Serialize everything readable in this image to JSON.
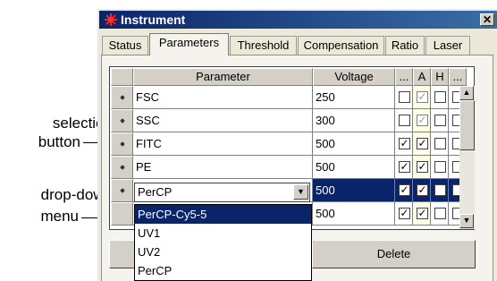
{
  "window": {
    "title": "Instrument"
  },
  "tabs": [
    "Status",
    "Parameters",
    "Threshold",
    "Compensation",
    "Ratio",
    "Laser"
  ],
  "active_tab": "Parameters",
  "grid": {
    "headers": {
      "parameter": "Parameter",
      "voltage": "Voltage",
      "col_more1": "...",
      "col_a": "A",
      "col_h": "H",
      "col_more2": "..."
    },
    "rows": [
      {
        "parameter": "FSC",
        "voltage": "250",
        "log": false,
        "a": true,
        "a_disabled": true,
        "h": false,
        "w": false,
        "selected": false
      },
      {
        "parameter": "SSC",
        "voltage": "300",
        "log": false,
        "a": true,
        "a_disabled": true,
        "h": false,
        "w": false,
        "selected": false
      },
      {
        "parameter": "FITC",
        "voltage": "500",
        "log": true,
        "a": true,
        "a_disabled": false,
        "h": false,
        "w": false,
        "selected": false
      },
      {
        "parameter": "PE",
        "voltage": "500",
        "log": true,
        "a": true,
        "a_disabled": false,
        "h": false,
        "w": false,
        "selected": false
      },
      {
        "parameter": "PerCP",
        "voltage": "500",
        "log": true,
        "a": true,
        "a_disabled": false,
        "h": false,
        "w": false,
        "selected": true
      },
      {
        "parameter": "",
        "voltage": "500",
        "log": true,
        "a": true,
        "a_disabled": false,
        "h": false,
        "w": false,
        "selected": false
      }
    ]
  },
  "dropdown": {
    "value": "PerCP",
    "options": [
      "PerCP-Cy5-5",
      "UV1",
      "UV2",
      "PerCP"
    ],
    "highlighted": "PerCP-Cy5-5"
  },
  "buttons": {
    "delete": "Delete"
  },
  "callouts": {
    "selection_button_line1": "selection",
    "selection_button_line2": "button",
    "dropdown_menu_line1": "drop-down",
    "dropdown_menu_line2": "menu"
  },
  "icons": {
    "title": "burst-icon",
    "checkmark": "✓",
    "close": "close-icon",
    "scroll_up": "up-arrow-icon",
    "scroll_down": "down-arrow-icon",
    "dropdown": "down-arrow-icon"
  },
  "colors": {
    "titlebar": "#0a246a",
    "selection": "#0a246a",
    "a_column": "#fefde6",
    "window": "#ece9d8"
  }
}
